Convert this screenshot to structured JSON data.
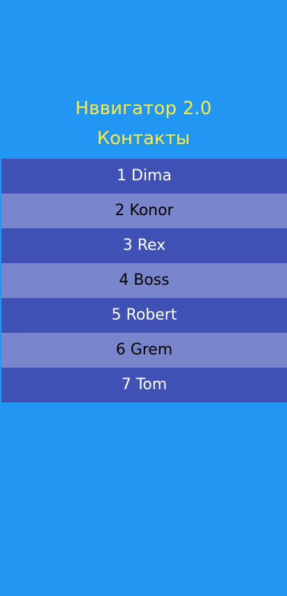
{
  "header": {
    "title": "Нввигатор 2.0",
    "subtitle": "Контакты"
  },
  "contacts": [
    {
      "label": "1 Dima"
    },
    {
      "label": "2 Konor"
    },
    {
      "label": "3 Rex"
    },
    {
      "label": "4 Boss"
    },
    {
      "label": "5 Robert"
    },
    {
      "label": "6 Grem"
    },
    {
      "label": "7 Tom"
    }
  ],
  "colors": {
    "background": "#2196f3",
    "header_text": "#ffeb3b",
    "row_dark": "#3f51b5",
    "row_light": "#7986cb"
  }
}
